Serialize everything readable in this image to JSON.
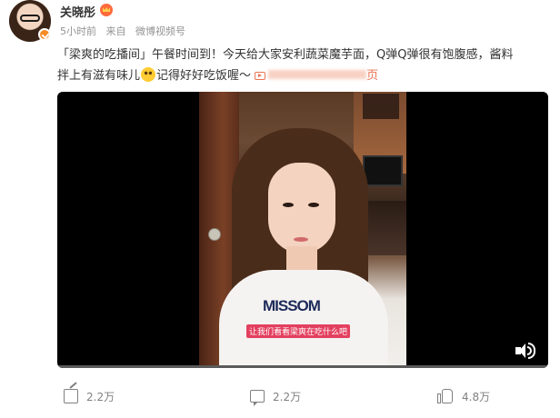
{
  "author": {
    "name": "关晓彤",
    "avatar_icon": "avatar-photo",
    "verified_icon": "verified-badge-icon",
    "crown_icon": "member-crown-icon"
  },
  "meta": {
    "time": "5小时前",
    "from_prefix": "来自",
    "source": "微博视频号"
  },
  "post": {
    "line1": "「梁爽的吃播间」午餐时间到！今天给大家安利蔬菜魔芋面，Q弹Q弹很有饱腹感，酱料",
    "line2_a": "拌上有滋有味儿",
    "line2_b": "记得好好吃饭喔～",
    "link_suffix": "页"
  },
  "video": {
    "subtitle": "让我们看看梁爽在吃什么吧",
    "shirt_text": "MISSOM",
    "progress": 0,
    "volume_icon": "speaker-icon"
  },
  "actions": {
    "share_count": "2.2万",
    "comment_count": "2.2万",
    "like_count": "4.8万"
  },
  "colors": {
    "accent": "#eb7350",
    "verified": "#f78b24",
    "text": "#333333",
    "meta": "#939393"
  }
}
